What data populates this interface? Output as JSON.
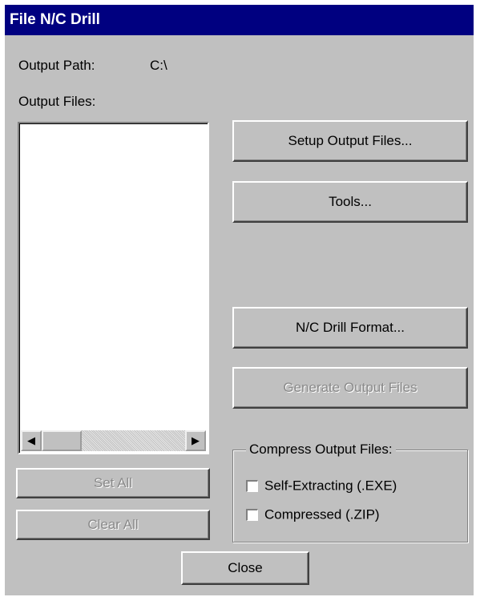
{
  "window": {
    "title": "File N/C Drill"
  },
  "output_path": {
    "label": "Output Path:",
    "value": "C:\\"
  },
  "output_files": {
    "label": "Output Files:",
    "items": []
  },
  "buttons": {
    "setup_output_files": "Setup Output Files...",
    "tools": "Tools...",
    "nc_drill_format": "N/C Drill Format...",
    "generate_output_files": "Generate Output Files",
    "set_all": "Set All",
    "clear_all": "Clear All",
    "close": "Close"
  },
  "compress": {
    "title": "Compress Output Files:",
    "self_extracting": {
      "label": "Self-Extracting (.EXE)",
      "checked": false
    },
    "compressed_zip": {
      "label": "Compressed (.ZIP)",
      "checked": false
    }
  },
  "scrollbar": {
    "left_arrow": "◀",
    "right_arrow": "▶"
  }
}
